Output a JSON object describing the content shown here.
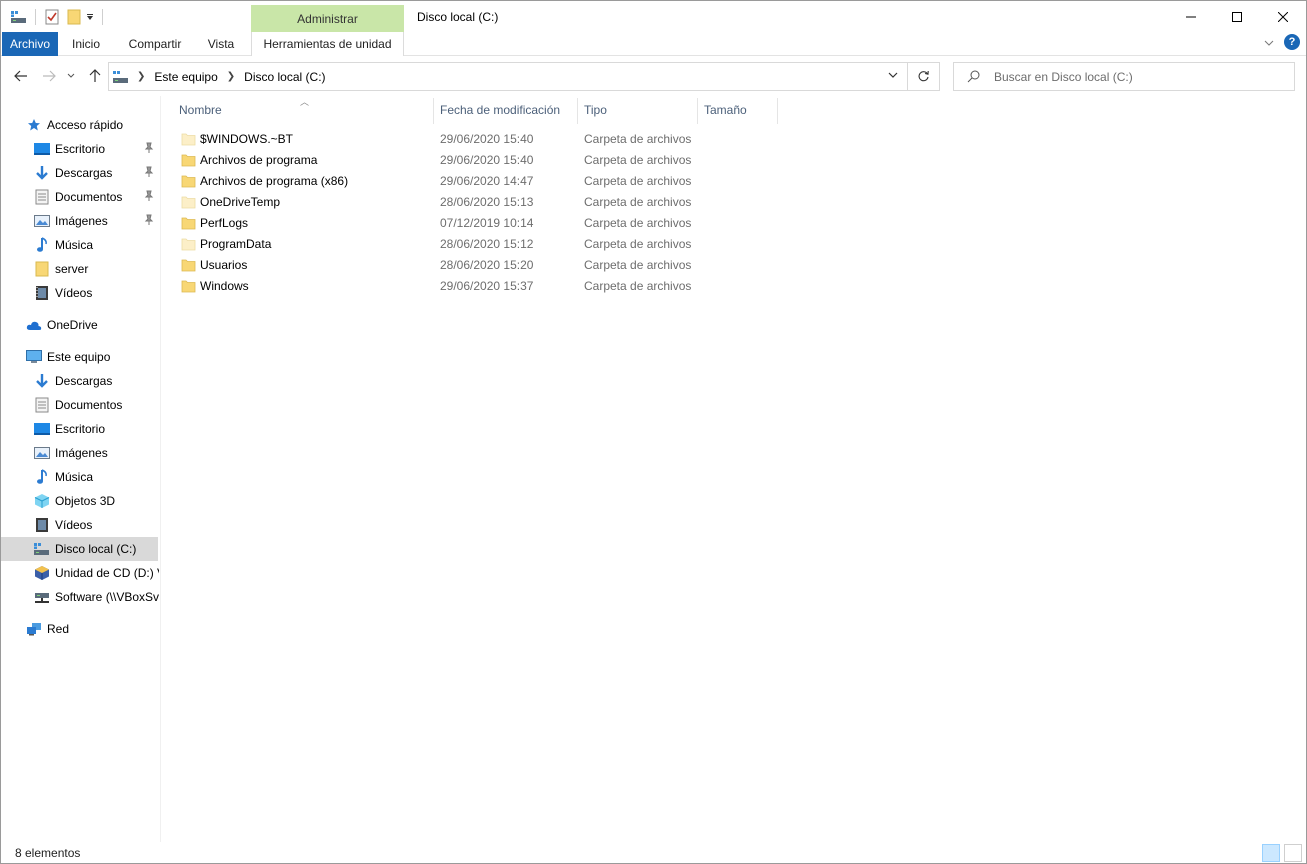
{
  "window": {
    "title": "Disco local (C:)",
    "context_tab_group": "Administrar"
  },
  "ribbon": {
    "tabs": [
      {
        "label": "Archivo"
      },
      {
        "label": "Inicio"
      },
      {
        "label": "Compartir"
      },
      {
        "label": "Vista"
      },
      {
        "label": "Herramientas de unidad"
      }
    ]
  },
  "address": {
    "crumbs": [
      "Este equipo",
      "Disco local (C:)"
    ]
  },
  "search": {
    "placeholder": "Buscar en Disco local (C:)"
  },
  "nav": {
    "quick_access": "Acceso rápido",
    "quick_items": [
      {
        "label": "Escritorio",
        "icon": "desktop-icon",
        "pinned": true
      },
      {
        "label": "Descargas",
        "icon": "download-icon",
        "pinned": true
      },
      {
        "label": "Documentos",
        "icon": "document-icon",
        "pinned": true
      },
      {
        "label": "Imágenes",
        "icon": "pictures-icon",
        "pinned": true
      },
      {
        "label": "Música",
        "icon": "music-icon",
        "pinned": false
      },
      {
        "label": "server",
        "icon": "folder-icon",
        "pinned": false
      },
      {
        "label": "Vídeos",
        "icon": "videos-icon",
        "pinned": false
      }
    ],
    "onedrive": "OneDrive",
    "this_pc": "Este equipo",
    "pc_items": [
      {
        "label": "Descargas",
        "icon": "download-icon"
      },
      {
        "label": "Documentos",
        "icon": "document-icon"
      },
      {
        "label": "Escritorio",
        "icon": "desktop-icon"
      },
      {
        "label": "Imágenes",
        "icon": "pictures-icon"
      },
      {
        "label": "Música",
        "icon": "music-icon"
      },
      {
        "label": "Objetos 3D",
        "icon": "objects-3d-icon"
      },
      {
        "label": "Vídeos",
        "icon": "videos-icon"
      },
      {
        "label": "Disco local (C:)",
        "icon": "drive-icon",
        "selected": true
      },
      {
        "label": "Unidad de CD (D:) V",
        "icon": "cd-drive-icon"
      },
      {
        "label": "Software (\\\\VBoxSv",
        "icon": "network-drive-icon"
      }
    ],
    "network": "Red"
  },
  "columns": {
    "name": "Nombre",
    "modified": "Fecha de modificación",
    "type": "Tipo",
    "size": "Tamaño"
  },
  "files": [
    {
      "name": "$WINDOWS.~BT",
      "modified": "29/06/2020 15:40",
      "type": "Carpeta de archivos",
      "faded": true
    },
    {
      "name": "Archivos de programa",
      "modified": "29/06/2020 15:40",
      "type": "Carpeta de archivos",
      "faded": false
    },
    {
      "name": "Archivos de programa (x86)",
      "modified": "29/06/2020 14:47",
      "type": "Carpeta de archivos",
      "faded": false
    },
    {
      "name": "OneDriveTemp",
      "modified": "28/06/2020 15:13",
      "type": "Carpeta de archivos",
      "faded": true
    },
    {
      "name": "PerfLogs",
      "modified": "07/12/2019 10:14",
      "type": "Carpeta de archivos",
      "faded": false
    },
    {
      "name": "ProgramData",
      "modified": "28/06/2020 15:12",
      "type": "Carpeta de archivos",
      "faded": true
    },
    {
      "name": "Usuarios",
      "modified": "28/06/2020 15:20",
      "type": "Carpeta de archivos",
      "faded": false
    },
    {
      "name": "Windows",
      "modified": "29/06/2020 15:37",
      "type": "Carpeta de archivos",
      "faded": false
    }
  ],
  "status": {
    "count": "8 elementos"
  },
  "colors": {
    "file_tab": "#1a67b6",
    "context_tab": "#c9e6a8",
    "selected_nav": "#d9d9d9",
    "folder": "#f8d775"
  }
}
